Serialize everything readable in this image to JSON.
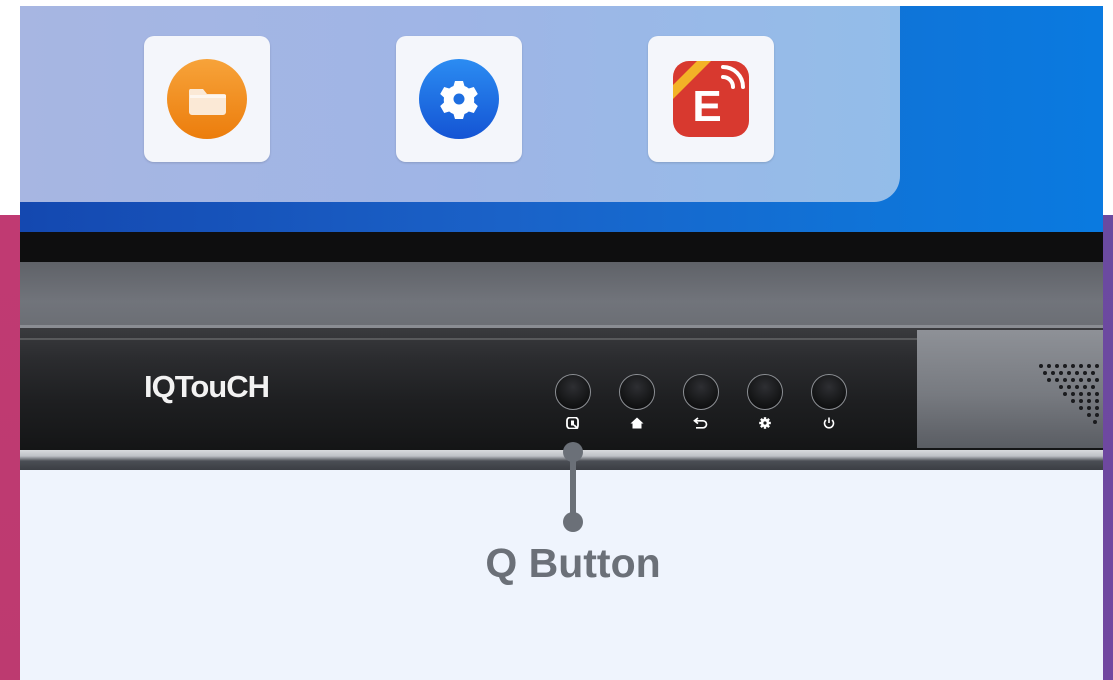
{
  "apps": [
    {
      "name": "folder",
      "icon": "folder-icon",
      "color": "#f08a12"
    },
    {
      "name": "settings",
      "icon": "gear-icon",
      "color": "#1d6fe6"
    },
    {
      "name": "eshare",
      "icon": "eshare-icon",
      "color": "#d83a32",
      "letter": "E"
    }
  ],
  "device": {
    "logo": "IQTouCH",
    "buttons": [
      {
        "name": "q-button",
        "icon": "q-icon"
      },
      {
        "name": "home-button",
        "icon": "home-icon"
      },
      {
        "name": "back-button",
        "icon": "back-icon"
      },
      {
        "name": "settings-button",
        "icon": "gear-icon"
      },
      {
        "name": "power-button",
        "icon": "power-icon"
      }
    ]
  },
  "callout": {
    "label": "Q Button",
    "color": "#6b7078"
  }
}
